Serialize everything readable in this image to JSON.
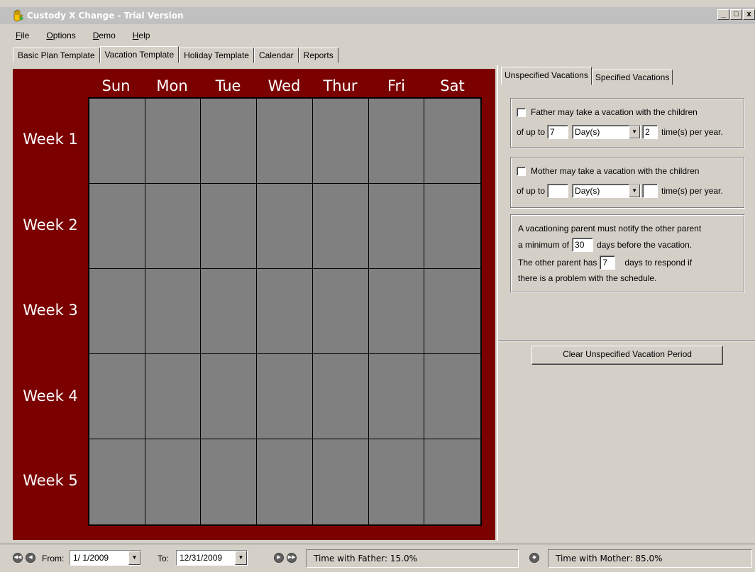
{
  "window": {
    "title": "Custody X Change - Trial Version",
    "min": "_",
    "max": "□",
    "close": "x"
  },
  "menu": [
    {
      "u": "F",
      "rest": "ile"
    },
    {
      "u": "O",
      "rest": "ptions"
    },
    {
      "u": "D",
      "rest": "emo"
    },
    {
      "u": "H",
      "rest": "elp"
    }
  ],
  "tabs": [
    "Basic Plan Template",
    "Vacation Template",
    "Holiday Template",
    "Calendar",
    "Reports"
  ],
  "calendar": {
    "days": [
      "Sun",
      "Mon",
      "Tue",
      "Wed",
      "Thur",
      "Fri",
      "Sat"
    ],
    "weeks": [
      "Week 1",
      "Week 2",
      "Week 3",
      "Week 4",
      "Week 5"
    ]
  },
  "subtabs": [
    "Unspecified Vacations",
    "Specified Vacations"
  ],
  "father": {
    "label": "Father may take a vacation with the children",
    "prefix": "of up to",
    "amount": "7",
    "unit": "Day(s)",
    "times": "2",
    "suffix": "time(s) per year."
  },
  "mother": {
    "label": "Mother may take a vacation with the children",
    "prefix": "of up to",
    "amount": "",
    "unit": "Day(s)",
    "times": "",
    "suffix": "time(s) per year."
  },
  "notify": {
    "line1": "A vacationing parent must notify the other parent",
    "line2a": "a minimum of",
    "days": "30",
    "line2b": "days before the vacation.",
    "line3a": "The other parent has",
    "respond": "7",
    "line3b": "days to respond if",
    "line4": "there is a problem with the schedule."
  },
  "clear_button": "Clear Unspecified Vacation Period",
  "status": {
    "from_label": "From:",
    "from_value": "1/ 1/2009",
    "to_label": "To:",
    "to_value": "12/31/2009",
    "father_time": "Time with Father: 15.0%",
    "mother_time": "Time with Mother: 85.0%"
  },
  "colors": {
    "calendar_bg": "#7b0000",
    "cell": "#808080",
    "chrome": "#d4d0c8"
  }
}
